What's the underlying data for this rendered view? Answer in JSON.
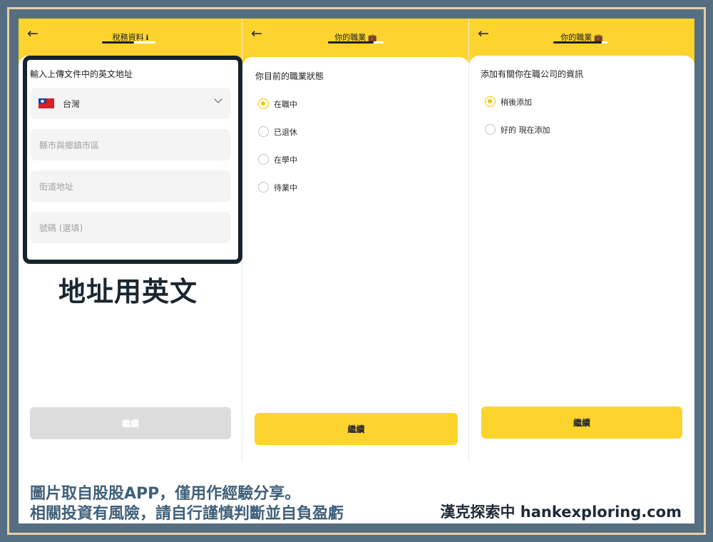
{
  "panel1": {
    "title": "稅務資料",
    "title_icon": "ℹ",
    "progress": 0.6,
    "heading": "輸入上傳文件中的英文地址",
    "country": "台灣",
    "placeholders": [
      "縣市與鄉鎮市區",
      "街道地址",
      "號碼 (選填)"
    ],
    "button": "繼續",
    "annotation": "地址用英文"
  },
  "panel2": {
    "title": "你的職業",
    "title_icon": "💼",
    "progress": 0.82,
    "question": "你目前的職業狀態",
    "options": [
      {
        "label": "在職中",
        "selected": true
      },
      {
        "label": "已退休",
        "selected": false
      },
      {
        "label": "在學中",
        "selected": false
      },
      {
        "label": "待業中",
        "selected": false
      }
    ],
    "button": "繼續"
  },
  "panel3": {
    "title": "你的職業",
    "title_icon": "💼",
    "progress": 0.9,
    "question": "添加有關你在職公司的資訊",
    "options": [
      {
        "label": "稍後添加",
        "selected": true
      },
      {
        "label": "好的 現在添加",
        "selected": false
      }
    ],
    "button": "繼續"
  },
  "caption": {
    "line1": "圖片取自股股APP，僅用作經驗分享。",
    "line2": "相關投資有風險，請自行謹慎判斷並自負盈虧",
    "brand": "漢克探索中 hankexploring.com"
  },
  "colors": {
    "accent_yellow": "#fdd42e",
    "radio_yellow": "#f5c400",
    "frame_bg": "#566e82",
    "frame_border": "#e7cfa6",
    "caption_blue": "#40607a"
  }
}
